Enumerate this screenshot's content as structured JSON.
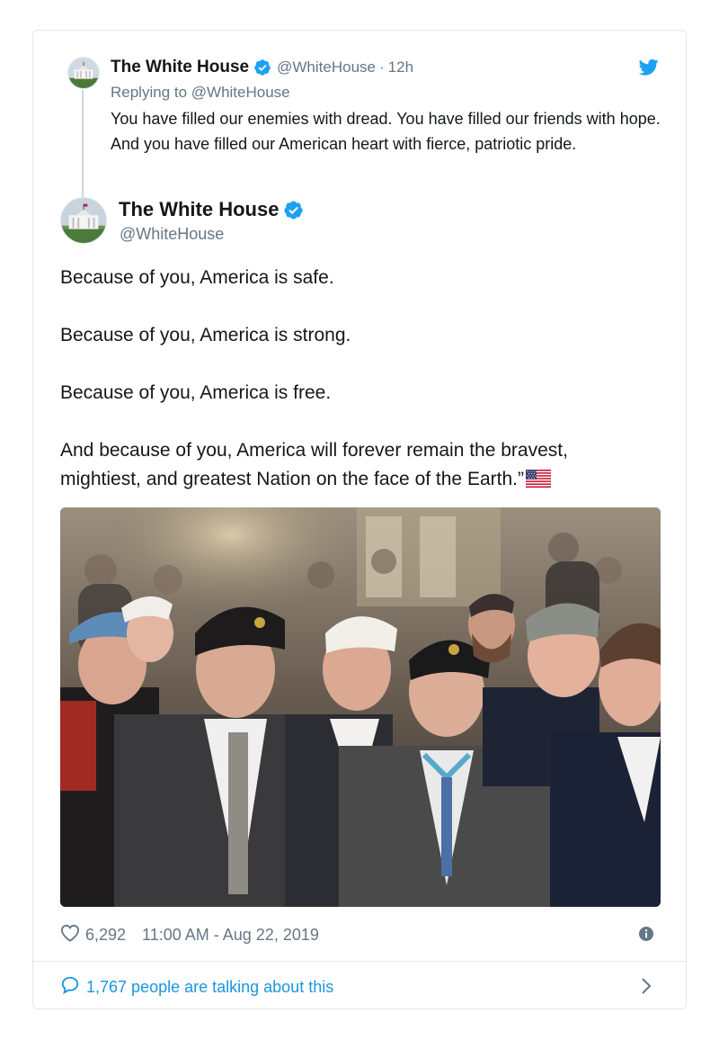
{
  "reply_tweet": {
    "author_name": "The White House",
    "handle": "@WhiteHouse",
    "separator": "·",
    "time_ago": "12h",
    "replying_to": "Replying to @WhiteHouse",
    "text": "You have filled our enemies with dread. You have filled our friends with hope. And you have filled our American heart with fierce, patriotic pride."
  },
  "main_tweet": {
    "author_name": "The White House",
    "handle": "@WhiteHouse",
    "paragraphs": [
      "Because of you, America is safe.",
      "Because of you, America is strong.",
      "Because of you, America is free.",
      "And because of you, America will forever remain the bravest, mightiest, and greatest Nation on the face of the Earth.”"
    ],
    "likes": "6,292",
    "timestamp": "11:00 AM - Aug 22, 2019",
    "talking": "1,767 people are talking about this"
  },
  "icons": {
    "verified": "verified-badge-icon",
    "bird": "twitter-bird-icon",
    "heart": "heart-icon",
    "info": "info-icon",
    "bubble": "speech-bubble-icon",
    "chevron": "chevron-right-icon",
    "flag": "us-flag-icon"
  },
  "colors": {
    "brand_blue": "#1da1f2",
    "link_blue": "#1b95e0",
    "secondary_text": "#657786",
    "border": "#e1e8ed"
  }
}
